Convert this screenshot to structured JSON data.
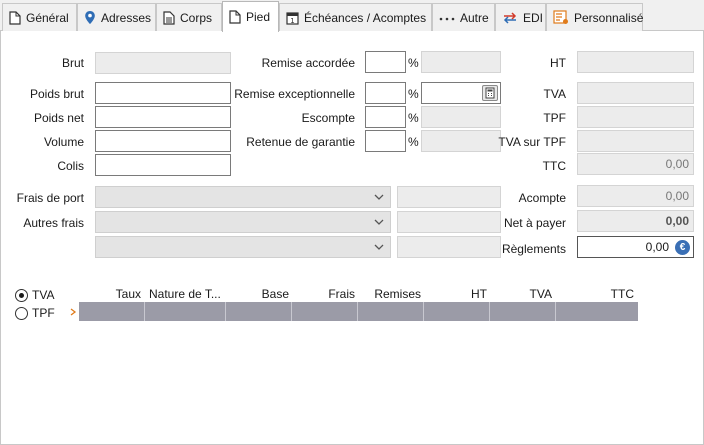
{
  "tabs": [
    {
      "label": "Général",
      "icon": "document-icon"
    },
    {
      "label": "Adresses",
      "icon": "map-pin-icon"
    },
    {
      "label": "Corps",
      "icon": "document-lines-icon"
    },
    {
      "label": "Pied",
      "icon": "document-icon"
    },
    {
      "label": "Échéances / Acomptes",
      "icon": "calendar-icon"
    },
    {
      "label": "Autre",
      "icon": "ellipsis-icon"
    },
    {
      "label": "EDI",
      "icon": "exchange-arrows-icon"
    },
    {
      "label": "Personnalisé",
      "icon": "custom-form-icon"
    }
  ],
  "active_tab": "Pied",
  "left_fields": {
    "brut": "Brut",
    "poids_brut": "Poids brut",
    "poids_net": "Poids net",
    "volume": "Volume",
    "colis": "Colis"
  },
  "middle_fields": {
    "remise_accordee": "Remise accordée",
    "remise_exceptionnelle": "Remise exceptionnelle",
    "escompte": "Escompte",
    "retenue_garantie": "Retenue de garantie",
    "percent": "%"
  },
  "right_fields": {
    "ht": "HT",
    "tva": "TVA",
    "tpf": "TPF",
    "tva_sur_tpf": "TVA sur TPF",
    "ttc": "TTC",
    "ttc_value": "0,00",
    "acompte": "Acompte",
    "acompte_value": "0,00",
    "net_a_payer": "Net à payer",
    "net_a_payer_value": "0,00",
    "reglements": "Règlements",
    "reglements_value": "0,00"
  },
  "frais": {
    "frais_de_port": "Frais de port",
    "autres_frais": "Autres frais"
  },
  "radio": {
    "tva": "TVA",
    "tpf": "TPF",
    "selected": "TVA"
  },
  "grid": {
    "columns": [
      "Taux",
      "Nature de T...",
      "Base",
      "Frais",
      "Remises",
      "HT",
      "TVA",
      "TTC"
    ]
  },
  "colors": {
    "grid_row": "#9b9ba7",
    "readonly_bg": "#ececec",
    "accent": "#3a6fb5"
  }
}
